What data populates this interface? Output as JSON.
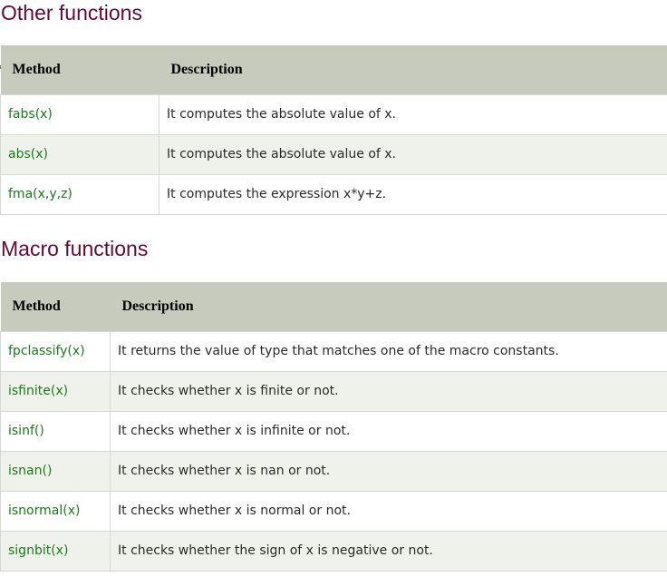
{
  "sections": [
    {
      "title": "Other functions",
      "columns": [
        "Method",
        "Description"
      ],
      "rows": [
        {
          "method": "fabs(x)",
          "description": "It computes the absolute value of x."
        },
        {
          "method": "abs(x)",
          "description": "It computes the absolute value of x."
        },
        {
          "method": "fma(x,y,z)",
          "description": "It computes the expression x*y+z."
        }
      ]
    },
    {
      "title": "Macro functions",
      "columns": [
        "Method",
        "Description"
      ],
      "rows": [
        {
          "method": "fpclassify(x)",
          "description": "It returns the value of type that matches one of the macro constants."
        },
        {
          "method": "isfinite(x)",
          "description": "It checks whether x is finite or not."
        },
        {
          "method": "isinf()",
          "description": "It checks whether x is infinite or not."
        },
        {
          "method": "isnan()",
          "description": "It checks whether x is nan or not."
        },
        {
          "method": "isnormal(x)",
          "description": "It checks whether x is normal or not."
        },
        {
          "method": "signbit(x)",
          "description": "It checks whether the sign of x is negative or not."
        }
      ]
    }
  ],
  "colors": {
    "heading": "#610b38",
    "header_bg": "#c7cbbd",
    "method_text": "#1a7a1a",
    "row_alt_bg": "#eff2ea"
  }
}
